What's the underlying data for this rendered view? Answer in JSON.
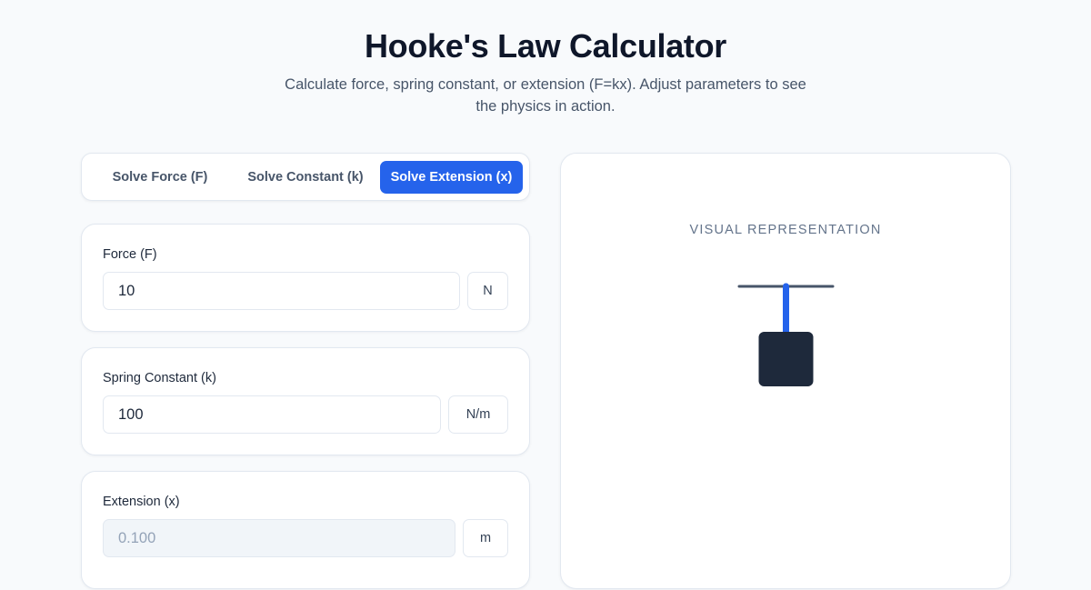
{
  "header": {
    "title": "Hooke's Law Calculator",
    "subtitle": "Calculate force, spring constant, or extension (F=kx). Adjust parameters to see the physics in action."
  },
  "tabs": [
    {
      "label": "Solve Force (F)",
      "active": false
    },
    {
      "label": "Solve Constant (k)",
      "active": false
    },
    {
      "label": "Solve Extension (x)",
      "active": true
    }
  ],
  "fields": {
    "force": {
      "label": "Force (F)",
      "value": "10",
      "unit": "N"
    },
    "constant": {
      "label": "Spring Constant (k)",
      "value": "100",
      "unit": "N/m"
    },
    "extension": {
      "label": "Extension (x)",
      "value": "0.100",
      "unit": "m",
      "readonly": true
    }
  },
  "visual": {
    "heading": "VISUAL REPRESENTATION",
    "colors": {
      "spring": "#2563eb",
      "mass": "#1e293b",
      "ceiling": "#475569"
    }
  },
  "theme": {
    "accent": "#2563eb",
    "background": "#f8fafc"
  }
}
